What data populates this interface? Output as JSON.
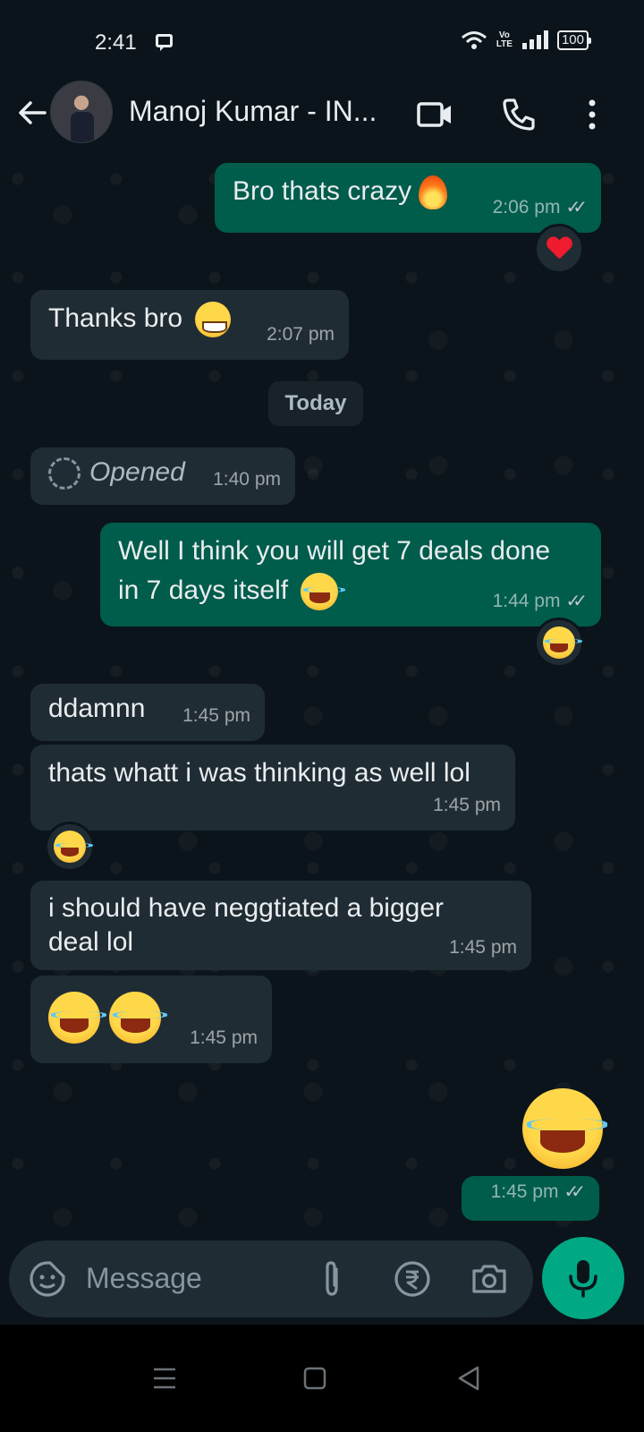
{
  "status_bar": {
    "time": "2:41",
    "network_top": "Vo",
    "network_bottom": "LTE",
    "battery": "100"
  },
  "header": {
    "contact_name": "Manoj Kumar - IN..."
  },
  "messages": [
    {
      "dir": "out",
      "text": "Bro thats crazy",
      "emoji": "fire",
      "time": "2:06 pm",
      "reaction": "heart"
    },
    {
      "dir": "in",
      "text": "Thanks bro",
      "emoji": "grin",
      "time": "2:07 pm"
    },
    {
      "type": "date",
      "text": "Today"
    },
    {
      "dir": "in",
      "text": "Opened",
      "time": "1:40 pm",
      "kind": "view-once"
    },
    {
      "dir": "out",
      "text_line1": "Well I think you will get 7 deals done",
      "text_line2": "in 7 days itself",
      "emoji": "laugh",
      "time": "1:44 pm",
      "reaction": "laugh"
    },
    {
      "dir": "in",
      "text": "ddamnn",
      "time": "1:45 pm"
    },
    {
      "dir": "in",
      "text": "thats whatt i was thinking as well lol",
      "time": "1:45 pm",
      "reaction": "laugh"
    },
    {
      "dir": "in",
      "text_line1": "i should have neggtiated a bigger",
      "text_line2": "deal lol",
      "time": "1:45 pm"
    },
    {
      "dir": "in",
      "emoji": "laugh x2",
      "time": "1:45 pm"
    },
    {
      "dir": "out",
      "emoji": "laugh",
      "time": "1:45 pm"
    }
  ],
  "input_bar": {
    "placeholder": "Message"
  },
  "icons": [
    "back-arrow-icon",
    "video-call-icon",
    "voice-call-icon",
    "more-options-icon",
    "sticker-icon",
    "attach-icon",
    "rupee-payment-icon",
    "camera-icon",
    "mic-icon"
  ],
  "colors": {
    "background": "#0b141a",
    "incoming_bubble": "#202c33",
    "outgoing_bubble": "#005c4b",
    "accent": "#00a884"
  }
}
